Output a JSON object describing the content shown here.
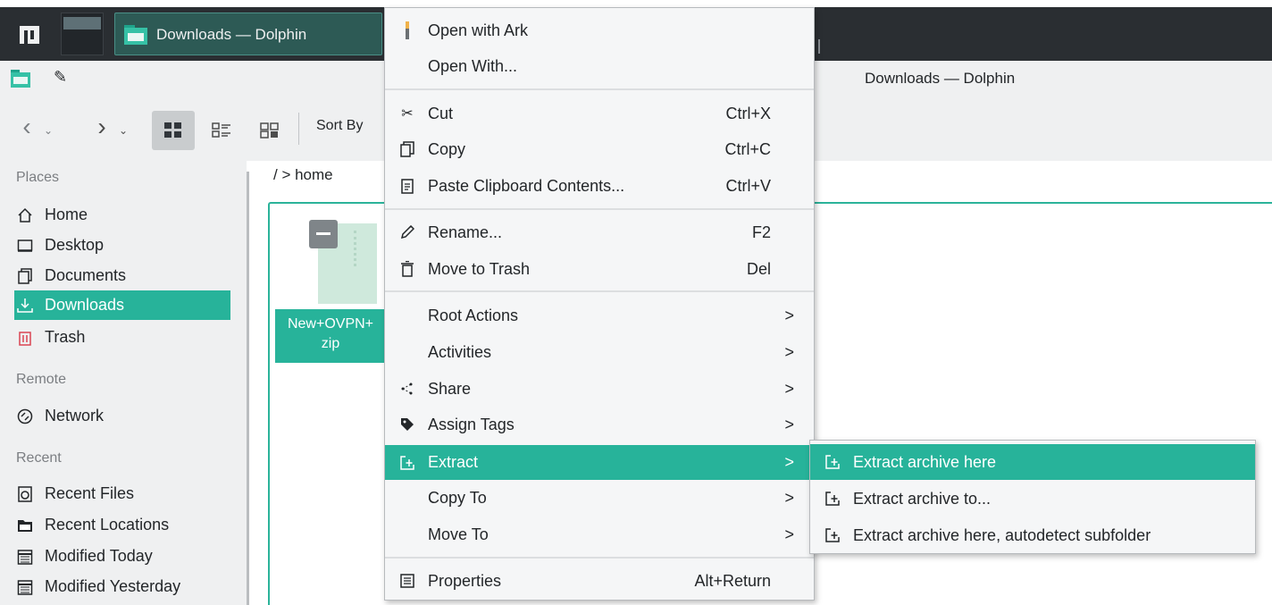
{
  "taskbar": {
    "task_label": "Downloads — Dolphin"
  },
  "window": {
    "title": "Downloads — Dolphin"
  },
  "toolbar": {
    "sort_by": "Sort By"
  },
  "breadcrumb": "/  >  home",
  "sidebar": {
    "places_header": "Places",
    "places": [
      {
        "label": "Home",
        "icon": "home-icon"
      },
      {
        "label": "Desktop",
        "icon": "desktop-icon"
      },
      {
        "label": "Documents",
        "icon": "documents-icon"
      },
      {
        "label": "Downloads",
        "icon": "downloads-icon",
        "selected": true
      },
      {
        "label": "Trash",
        "icon": "trash-icon"
      }
    ],
    "remote_header": "Remote",
    "remote": [
      {
        "label": "Network",
        "icon": "network-icon"
      }
    ],
    "recent_header": "Recent",
    "recent": [
      {
        "label": "Recent Files",
        "icon": "recent-files-icon"
      },
      {
        "label": "Recent Locations",
        "icon": "recent-locations-icon"
      },
      {
        "label": "Modified Today",
        "icon": "calendar-icon"
      },
      {
        "label": "Modified Yesterday",
        "icon": "calendar-icon"
      }
    ]
  },
  "file": {
    "name_line1": "New+OVPN+",
    "name_line2": "zip"
  },
  "context_menu": {
    "items": [
      {
        "label": "Open with Ark",
        "icon": "ark-icon"
      },
      {
        "label": "Open With...",
        "icon": ""
      },
      {
        "label": "Cut",
        "shortcut": "Ctrl+X",
        "icon": "cut-icon"
      },
      {
        "label": "Copy",
        "shortcut": "Ctrl+C",
        "icon": "copy-icon"
      },
      {
        "label": "Paste Clipboard Contents...",
        "shortcut": "Ctrl+V",
        "icon": "paste-icon"
      },
      {
        "label": "Rename...",
        "shortcut": "F2",
        "icon": "rename-icon"
      },
      {
        "label": "Move to Trash",
        "shortcut": "Del",
        "icon": "trash-icon"
      },
      {
        "label": "Root Actions",
        "arrow": ">"
      },
      {
        "label": "Activities",
        "arrow": ">"
      },
      {
        "label": "Share",
        "arrow": ">",
        "icon": "share-icon"
      },
      {
        "label": "Assign Tags",
        "arrow": ">",
        "icon": "tag-icon"
      },
      {
        "label": "Extract",
        "arrow": ">",
        "icon": "extract-icon",
        "highlighted": true
      },
      {
        "label": "Copy To",
        "arrow": ">"
      },
      {
        "label": "Move To",
        "arrow": ">"
      },
      {
        "label": "Properties",
        "shortcut": "Alt+Return",
        "icon": "properties-icon"
      }
    ]
  },
  "extract_submenu": {
    "items": [
      {
        "label": "Extract archive here",
        "highlighted": true
      },
      {
        "label": "Extract archive to..."
      },
      {
        "label": "Extract archive here, autodetect subfolder"
      }
    ]
  },
  "colors": {
    "accent": "#27b39a",
    "taskbar": "#2a2e32",
    "window_bg": "#eff0f1"
  }
}
